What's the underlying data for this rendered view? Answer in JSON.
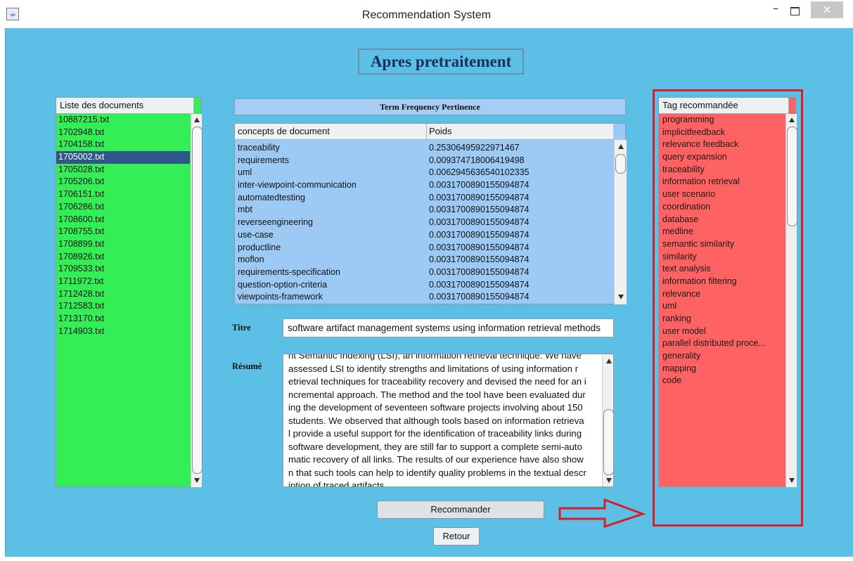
{
  "window": {
    "title": "Recommendation System",
    "icon": "java-app-icon"
  },
  "heading": "Apres pretraitement",
  "documents": {
    "header": "Liste des documents",
    "items": [
      "10887215.txt",
      "1702948.txt",
      "1704158.txt",
      "1705002.txt",
      "1705028.txt",
      "1705206.txt",
      "1706151.txt",
      "1706286.txt",
      "1708600.txt",
      "1708755.txt",
      "1708899.txt",
      "1708926.txt",
      "1709533.txt",
      "1711972.txt",
      "1712428.txt",
      "1712583.txt",
      "1713170.txt",
      "1714903.txt"
    ],
    "selected": "1705002.txt"
  },
  "term_frequency": {
    "title": "Term Frequency Pertinence",
    "columns": [
      "concepts de document",
      "Poids"
    ],
    "rows": [
      [
        "traceability",
        "0.25306495922971467"
      ],
      [
        "requirements",
        "0.009374718006419498"
      ],
      [
        "uml",
        "0.0062945636540102335"
      ],
      [
        "inter-viewpoint-communication",
        "0.0031700890155094874"
      ],
      [
        "automatedtesting",
        "0.0031700890155094874"
      ],
      [
        "mbt",
        "0.0031700890155094874"
      ],
      [
        "reverseengineering",
        "0.0031700890155094874"
      ],
      [
        "use-case",
        "0.0031700890155094874"
      ],
      [
        "productline",
        "0.0031700890155094874"
      ],
      [
        "moflon",
        "0.0031700890155094874"
      ],
      [
        "requirements-specification",
        "0.0031700890155094874"
      ],
      [
        "question-option-criteria",
        "0.0031700890155094874"
      ],
      [
        "viewpoints-framework",
        "0.0031700890155094874"
      ]
    ]
  },
  "form": {
    "titre_label": "Titre",
    "titre_value": "software artifact management systems using information retrieval methods",
    "resume_label": "Résumé",
    "resume_lines": [
      "nt Semantic Indexing (LSI), an information retrieval technique. We have",
      "assessed LSI to identify strengths and limitations of using information r",
      "etrieval techniques for traceability recovery and devised the need for an i",
      "ncremental approach. The method and the tool have been evaluated dur",
      "ing the development of seventeen software projects involving about 150",
      "students. We observed that although tools based on information retrieva",
      "l provide a useful support for the identification of traceability links during",
      "software development, they are still far to support a complete semi-auto",
      "matic recovery of all links. The results of our experience have also show",
      "n that such tools can help to identify quality problems in the textual descr",
      "iption of traced artifacts."
    ]
  },
  "buttons": {
    "recommander": "Recommander",
    "retour": "Retour"
  },
  "tags": {
    "header": "Tag recommandée",
    "items": [
      "programming",
      "implicitfeedback",
      "relevance feedback",
      "query expansion",
      "traceability",
      "information retrieval",
      "user scenario",
      "coordination",
      "database",
      "medline",
      "semantic similarity",
      "similarity",
      "text analysis",
      "information filtering",
      "relevance",
      "uml",
      "ranking",
      "user model",
      "parallel distributed proce...",
      "generality",
      "mapping",
      "code"
    ]
  },
  "colors": {
    "background": "#5bbfe6",
    "docs_list": "#33ee55",
    "tags_list": "#ff6262",
    "table": "#9dcaf5",
    "highlight": "#d81e26"
  }
}
